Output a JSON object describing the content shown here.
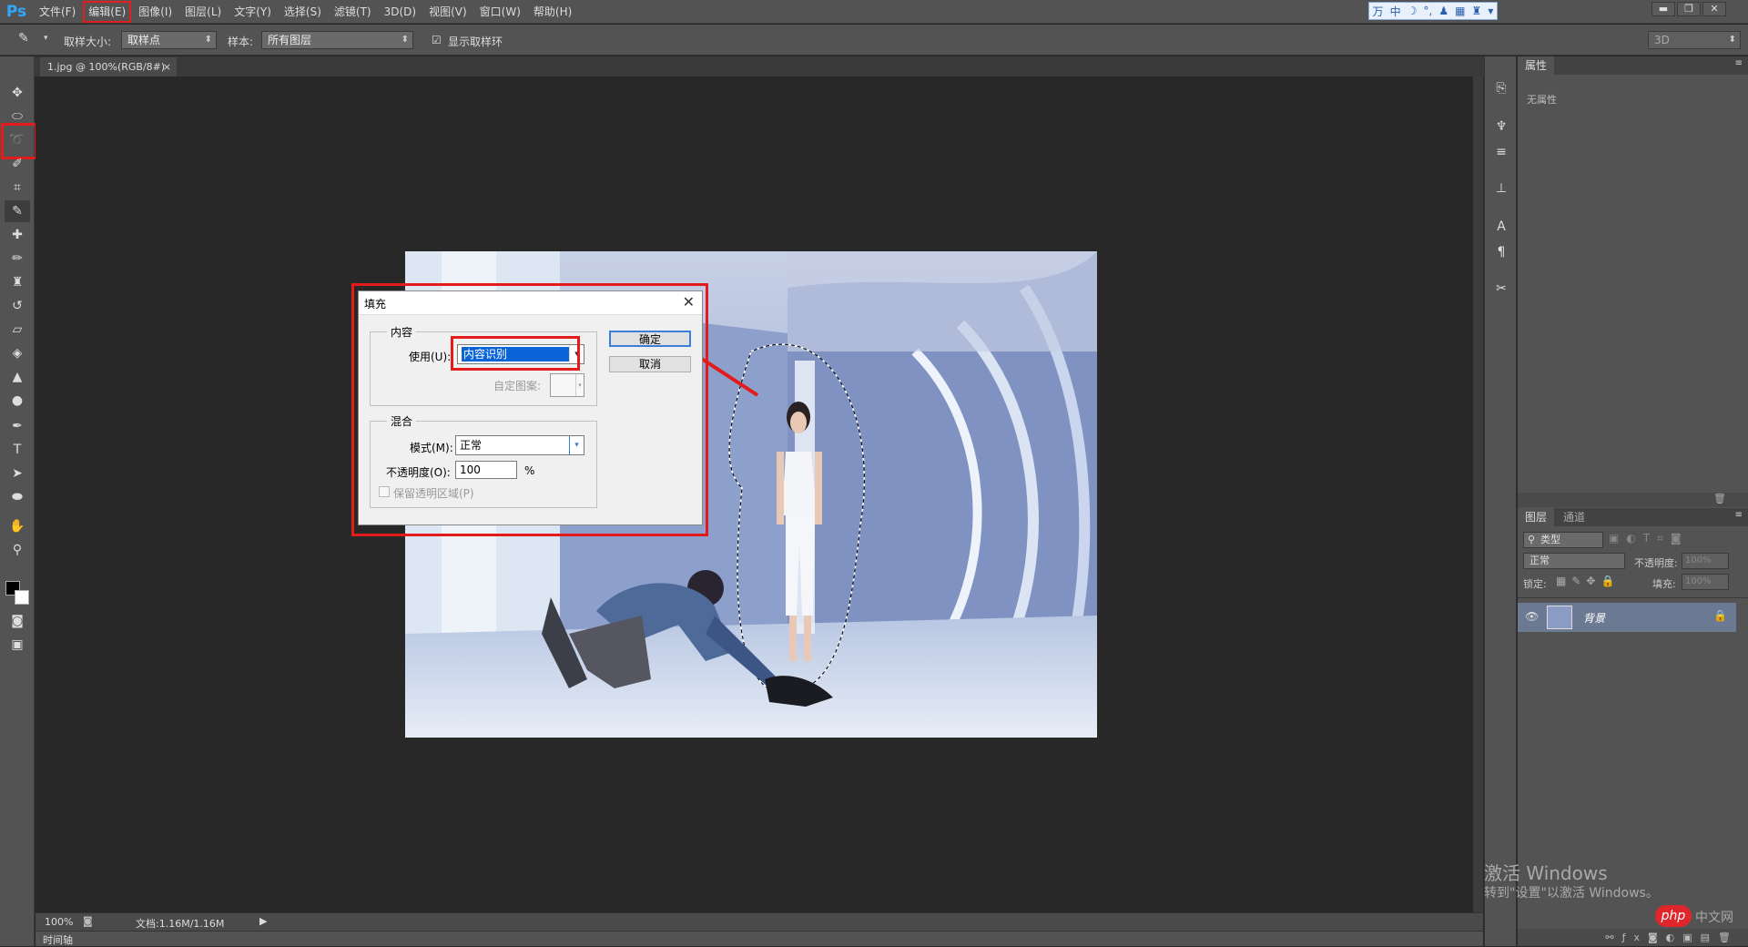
{
  "app": {
    "logo": "Ps"
  },
  "menu": [
    "文件(F)",
    "编辑(E)",
    "图像(I)",
    "图层(L)",
    "文字(Y)",
    "选择(S)",
    "滤镜(T)",
    "3D(D)",
    "视图(V)",
    "窗口(W)",
    "帮助(H)"
  ],
  "ime": [
    "万",
    "中",
    "☽",
    "°,",
    "♟",
    "▦",
    "♜",
    "▾"
  ],
  "window_controls": {
    "minimize": "▬",
    "restore": "❐",
    "close": "✕"
  },
  "options": {
    "sample_size_label": "取样大小:",
    "sample_size_value": "取样点",
    "sample_label": "样本:",
    "sample_value": "所有图层",
    "show_ring_label": "显示取样环",
    "workspace": "3D"
  },
  "document_tab": {
    "title": "1.jpg @ 100%(RGB/8#)",
    "close": "×"
  },
  "status": {
    "zoom": "100%",
    "doc": "文档:1.16M/1.16M",
    "timeline": "时间轴"
  },
  "dialog": {
    "title": "填充",
    "content_legend": "内容",
    "use_label": "使用(U):",
    "use_value": "内容识别",
    "custom_pattern_label": "自定图案:",
    "blend_legend": "混合",
    "mode_label": "模式(M):",
    "mode_value": "正常",
    "opacity_label": "不透明度(O):",
    "opacity_value": "100",
    "opacity_unit": "%",
    "preserve_label": "保留透明区域(P)",
    "ok": "确定",
    "cancel": "取消"
  },
  "properties": {
    "tab": "属性",
    "empty": "无属性"
  },
  "layers": {
    "tabs": [
      "图层",
      "通道"
    ],
    "filter": "类型",
    "blend": "正常",
    "opacity_label": "不透明度:",
    "opacity_value": "100%",
    "lock_label": "锁定:",
    "fill_label": "填充:",
    "fill_value": "100%",
    "layer_name": "背景"
  },
  "watermark": {
    "line1": "激活 Windows",
    "line2": "转到\"设置\"以激活 Windows。",
    "badge": "php",
    "badge_text": "中文网"
  },
  "colors": {
    "accent_red": "#e31b1b",
    "ps_blue": "#31a8ff",
    "dialog_bg": "#f0f0f0",
    "selection_blue": "#0a64d8"
  }
}
